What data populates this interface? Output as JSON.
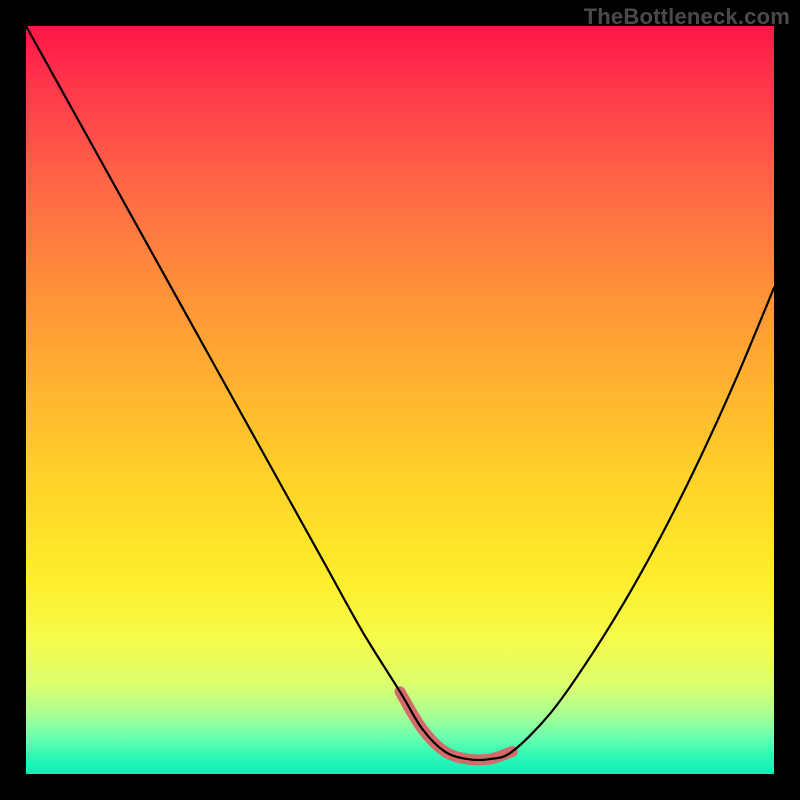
{
  "watermark": "TheBottleneck.com",
  "colors": {
    "page_background": "#000000",
    "curve_stroke": "#000000",
    "dip_highlight": "#d46a6a",
    "gradient_top": "#ff1648",
    "gradient_bottom": "#0bf0b6",
    "watermark_text": "#4a4a4a"
  },
  "chart_data": {
    "type": "line",
    "title": "",
    "xlabel": "",
    "ylabel": "",
    "xlim": [
      0,
      100
    ],
    "ylim": [
      0,
      100
    ],
    "grid": false,
    "legend": false,
    "x": [
      0,
      5,
      10,
      15,
      20,
      25,
      30,
      35,
      40,
      45,
      50,
      53,
      56,
      59,
      62,
      65,
      70,
      75,
      80,
      85,
      90,
      95,
      100
    ],
    "values": [
      100,
      91,
      82,
      73,
      64,
      55,
      46,
      37,
      28,
      19,
      11,
      6,
      3,
      2,
      2,
      3,
      8,
      15,
      23,
      32,
      42,
      53,
      65
    ],
    "highlight_range_x": [
      51,
      66
    ],
    "background_gradient_stops": [
      {
        "pos": 0.0,
        "color": "#ff1648"
      },
      {
        "pos": 0.1,
        "color": "#ff3e4a"
      },
      {
        "pos": 0.22,
        "color": "#ff6a46"
      },
      {
        "pos": 0.36,
        "color": "#ff9238"
      },
      {
        "pos": 0.5,
        "color": "#ffb82f"
      },
      {
        "pos": 0.62,
        "color": "#ffd528"
      },
      {
        "pos": 0.74,
        "color": "#feee2c"
      },
      {
        "pos": 0.82,
        "color": "#f6fb4a"
      },
      {
        "pos": 0.88,
        "color": "#dcff6e"
      },
      {
        "pos": 0.92,
        "color": "#aaff92"
      },
      {
        "pos": 0.95,
        "color": "#6dffad"
      },
      {
        "pos": 0.975,
        "color": "#30f8b5"
      },
      {
        "pos": 1.0,
        "color": "#0bf0b6"
      }
    ]
  }
}
